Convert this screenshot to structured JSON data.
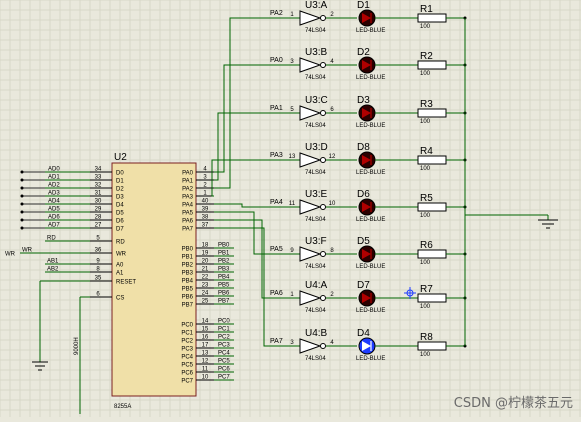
{
  "chip": {
    "ref": "U2",
    "part": "8255A",
    "left_pins": [
      "D0",
      "D1",
      "D2",
      "D3",
      "D4",
      "D5",
      "D6",
      "D7",
      "RD",
      "WR",
      "A0",
      "A1",
      "RESET",
      "CS"
    ],
    "left_nums": [
      "34",
      "33",
      "32",
      "31",
      "30",
      "29",
      "28",
      "27",
      "5",
      "36",
      "9",
      "8",
      "35",
      "6"
    ],
    "right_a": [
      "PA0",
      "PA1",
      "PA2",
      "PA3",
      "PA4",
      "PA5",
      "PA6",
      "PA7"
    ],
    "right_a_nums": [
      "4",
      "3",
      "2",
      "1",
      "40",
      "39",
      "38",
      "37"
    ],
    "right_b": [
      "PB0",
      "PB1",
      "PB2",
      "PB3",
      "PB4",
      "PB5",
      "PB6",
      "PB7"
    ],
    "right_b_nums": [
      "18",
      "19",
      "20",
      "21",
      "22",
      "23",
      "24",
      "25"
    ],
    "right_c": [
      "PC0",
      "PC1",
      "PC2",
      "PC3",
      "PC4",
      "PC5",
      "PC6",
      "PC7"
    ],
    "right_c_nums": [
      "14",
      "15",
      "16",
      "17",
      "13",
      "12",
      "11",
      "10"
    ]
  },
  "bus_labels": {
    "ad": [
      "AD0",
      "AD1",
      "AD2",
      "AD3",
      "AD4",
      "AD5",
      "AD6",
      "AD7"
    ],
    "rd": "RD",
    "wr": "WR",
    "ab1": "AB1",
    "ab2": "AB2",
    "addr": "9000H"
  },
  "pb_net": [
    "PB0",
    "PB1",
    "PB2",
    "PB3",
    "PB4",
    "PB5",
    "PB6",
    "PB7"
  ],
  "pc_net": [
    "PC0",
    "PC1",
    "PC2",
    "PC3",
    "PC4",
    "PC5",
    "PC6",
    "PC7"
  ],
  "channels": [
    {
      "net": "PA2",
      "gate": "U3:A",
      "in_pin": "1",
      "out_pin": "2",
      "part": "74LS04",
      "led": "D1",
      "led_part": "LED-BLUE",
      "res": "R1",
      "res_val": "100"
    },
    {
      "net": "PA0",
      "gate": "U3:B",
      "in_pin": "3",
      "out_pin": "4",
      "part": "74LS04",
      "led": "D2",
      "led_part": "LED-BLUE",
      "res": "R2",
      "res_val": "100"
    },
    {
      "net": "PA1",
      "gate": "U3:C",
      "in_pin": "5",
      "out_pin": "6",
      "part": "74LS04",
      "led": "D3",
      "led_part": "LED-BLUE",
      "res": "R3",
      "res_val": "100"
    },
    {
      "net": "PA3",
      "gate": "U3:D",
      "in_pin": "13",
      "out_pin": "12",
      "part": "74LS04",
      "led": "D8",
      "led_part": "LED-BLUE",
      "res": "R4",
      "res_val": "100"
    },
    {
      "net": "PA4",
      "gate": "U3:E",
      "in_pin": "11",
      "out_pin": "10",
      "part": "74LS04",
      "led": "D6",
      "led_part": "LED-BLUE",
      "res": "R5",
      "res_val": "100"
    },
    {
      "net": "PA5",
      "gate": "U3:F",
      "in_pin": "9",
      "out_pin": "8",
      "part": "74LS04",
      "led": "D5",
      "led_part": "LED-BLUE",
      "res": "R6",
      "res_val": "100"
    },
    {
      "net": "PA6",
      "gate": "U4:A",
      "in_pin": "1",
      "out_pin": "2",
      "part": "74LS04",
      "led": "D7",
      "led_part": "LED-BLUE",
      "res": "R7",
      "res_val": "100"
    },
    {
      "net": "PA7",
      "gate": "U4:B",
      "in_pin": "3",
      "out_pin": "4",
      "part": "74LS04",
      "led": "D4",
      "led_part": "LED-BLUE",
      "res": "R8",
      "res_val": "100",
      "active": true
    }
  ],
  "colors": {
    "background": "#e9e8dc",
    "wire": "#006400",
    "chip_fill": "#f0e0a8",
    "led_off": "#b00000",
    "led_on": "#1e3cff",
    "label_active": "#ff0000"
  },
  "watermark": "CSDN @柠檬茶五元"
}
